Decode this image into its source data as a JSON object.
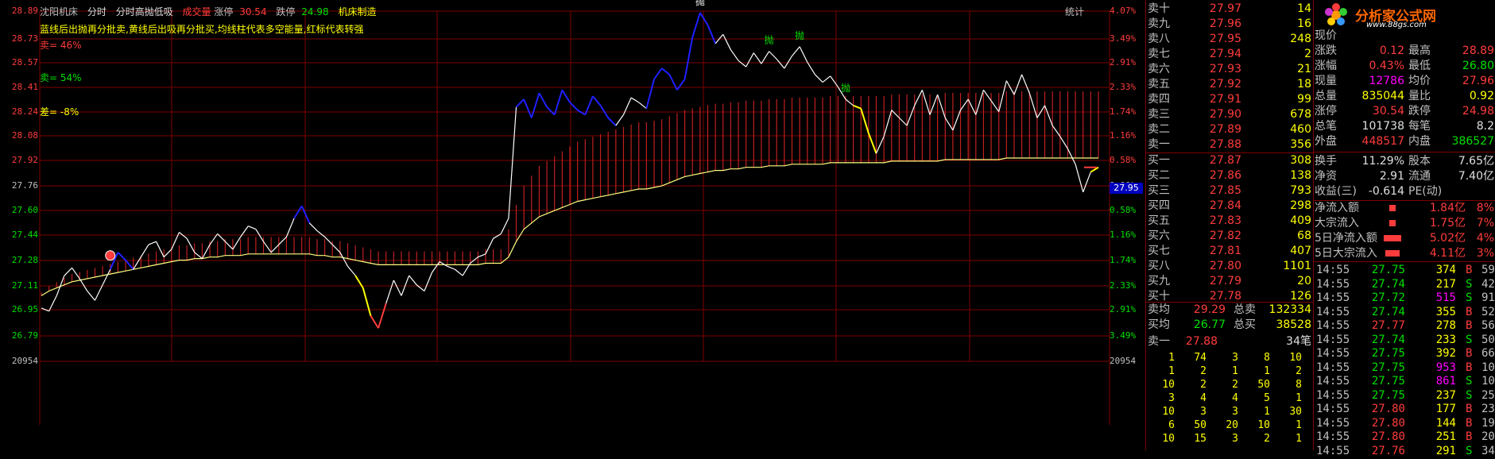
{
  "header": {
    "stock_name": "沈阳机床",
    "tab_fenshi": "分时",
    "indicator_name": "分时高抛低吸",
    "volume_label": "成交量",
    "limit_up_label": "涨停",
    "limit_up_value": "30.54",
    "limit_down_label": "跌停",
    "limit_down_value": "24.98",
    "credit": "机床制造",
    "hint_text": "蓝线后出抛再分批卖,黄线后出吸再分批买,均线柱代表多空能量,红标代表转强",
    "sell_pct": "卖= 46%",
    "sell2_pct": "卖= 54%",
    "diff_pct": "差= -8%",
    "stats_label": "统计"
  },
  "chart_data": {
    "type": "line",
    "y_left_ticks": [
      "28.89",
      "28.73",
      "28.57",
      "28.41",
      "28.24",
      "28.08",
      "27.92",
      "27.76",
      "27.60",
      "27.44",
      "27.28",
      "27.11",
      "26.95",
      "26.79",
      "20954"
    ],
    "y_right_ticks": [
      "4.07%",
      "3.49%",
      "2.91%",
      "2.33%",
      "1.74%",
      "1.16%",
      "0.58%",
      "0.00%",
      "0.58%",
      "1.16%",
      "1.74%",
      "2.33%",
      "2.91%",
      "3.49%",
      "20954"
    ],
    "current_price_tag": "27.95",
    "markers": [
      "抛",
      "抛",
      "抛",
      "抛"
    ],
    "price": [
      26.97,
      26.95,
      27.05,
      27.18,
      27.23,
      27.16,
      27.08,
      27.02,
      27.12,
      27.22,
      27.33,
      27.28,
      27.22,
      27.3,
      27.38,
      27.4,
      27.3,
      27.35,
      27.46,
      27.42,
      27.33,
      27.29,
      27.38,
      27.45,
      27.4,
      27.35,
      27.43,
      27.5,
      27.48,
      27.4,
      27.33,
      27.38,
      27.43,
      27.55,
      27.63,
      27.52,
      27.47,
      27.43,
      27.38,
      27.33,
      27.24,
      27.18,
      27.1,
      26.92,
      26.84,
      27.0,
      27.15,
      27.05,
      27.18,
      27.12,
      27.08,
      27.2,
      27.27,
      27.24,
      27.22,
      27.18,
      27.26,
      27.3,
      27.32,
      27.42,
      27.45,
      27.55,
      28.27,
      28.32,
      28.2,
      28.36,
      28.27,
      28.22,
      28.38,
      28.3,
      28.25,
      28.22,
      28.34,
      28.28,
      28.2,
      28.15,
      28.22,
      28.33,
      28.3,
      28.26,
      28.45,
      28.52,
      28.48,
      28.38,
      28.45,
      28.72,
      28.88,
      28.8,
      28.68,
      28.74,
      28.64,
      28.57,
      28.53,
      28.62,
      28.55,
      28.63,
      28.58,
      28.52,
      28.6,
      28.66,
      28.56,
      28.48,
      28.43,
      28.47,
      28.4,
      28.32,
      28.28,
      28.26,
      28.1,
      27.97,
      28.08,
      28.25,
      28.2,
      28.15,
      28.28,
      28.38,
      28.22,
      28.35,
      28.2,
      28.12,
      28.25,
      28.32,
      28.22,
      28.38,
      28.31,
      28.24,
      28.44,
      28.35,
      28.48,
      28.36,
      28.2,
      28.28,
      28.15,
      28.08,
      28.0,
      27.9,
      27.72,
      27.85,
      27.88
    ],
    "avg_price": [
      27.05,
      27.08,
      27.1,
      27.12,
      27.14,
      27.15,
      27.16,
      27.17,
      27.18,
      27.19,
      27.2,
      27.21,
      27.22,
      27.23,
      27.24,
      27.25,
      27.26,
      27.27,
      27.28,
      27.28,
      27.29,
      27.29,
      27.3,
      27.3,
      27.31,
      27.31,
      27.31,
      27.32,
      27.32,
      27.32,
      27.32,
      27.32,
      27.32,
      27.32,
      27.32,
      27.32,
      27.31,
      27.31,
      27.3,
      27.3,
      27.29,
      27.28,
      27.27,
      27.26,
      27.25,
      27.25,
      27.25,
      27.25,
      27.25,
      27.25,
      27.25,
      27.25,
      27.25,
      27.25,
      27.25,
      27.25,
      27.25,
      27.25,
      27.26,
      27.26,
      27.26,
      27.3,
      27.4,
      27.48,
      27.52,
      27.56,
      27.58,
      27.6,
      27.62,
      27.64,
      27.66,
      27.67,
      27.68,
      27.69,
      27.7,
      27.71,
      27.72,
      27.73,
      27.74,
      27.74,
      27.75,
      27.76,
      27.78,
      27.8,
      27.82,
      27.83,
      27.84,
      27.85,
      27.86,
      27.86,
      27.87,
      27.87,
      27.88,
      27.88,
      27.88,
      27.89,
      27.89,
      27.89,
      27.9,
      27.9,
      27.9,
      27.9,
      27.9,
      27.91,
      27.91,
      27.91,
      27.91,
      27.91,
      27.91,
      27.91,
      27.91,
      27.92,
      27.92,
      27.92,
      27.92,
      27.92,
      27.92,
      27.92,
      27.93,
      27.93,
      27.93,
      27.93,
      27.93,
      27.93,
      27.93,
      27.93,
      27.94,
      27.94,
      27.94,
      27.94,
      27.94,
      27.94,
      27.94,
      27.94,
      27.94,
      27.94,
      27.94,
      27.94,
      27.94
    ]
  },
  "orderbook": {
    "sells": [
      {
        "label": "卖十",
        "price": "27.97",
        "vol": "14"
      },
      {
        "label": "卖九",
        "price": "27.96",
        "vol": "16"
      },
      {
        "label": "卖八",
        "price": "27.95",
        "vol": "248"
      },
      {
        "label": "卖七",
        "price": "27.94",
        "vol": "2"
      },
      {
        "label": "卖六",
        "price": "27.93",
        "vol": "21"
      },
      {
        "label": "卖五",
        "price": "27.92",
        "vol": "18"
      },
      {
        "label": "卖四",
        "price": "27.91",
        "vol": "99"
      },
      {
        "label": "卖三",
        "price": "27.90",
        "vol": "678"
      },
      {
        "label": "卖二",
        "price": "27.89",
        "vol": "460"
      },
      {
        "label": "卖一",
        "price": "27.88",
        "vol": "356"
      }
    ],
    "buys": [
      {
        "label": "买一",
        "price": "27.87",
        "vol": "308"
      },
      {
        "label": "买二",
        "price": "27.86",
        "vol": "138"
      },
      {
        "label": "买三",
        "price": "27.85",
        "vol": "793"
      },
      {
        "label": "买四",
        "price": "27.84",
        "vol": "298"
      },
      {
        "label": "买五",
        "price": "27.83",
        "vol": "409"
      },
      {
        "label": "买六",
        "price": "27.82",
        "vol": "68"
      },
      {
        "label": "买七",
        "price": "27.81",
        "vol": "407"
      },
      {
        "label": "买八",
        "price": "27.80",
        "vol": "1101"
      },
      {
        "label": "买九",
        "price": "27.79",
        "vol": "20"
      },
      {
        "label": "买十",
        "price": "27.78",
        "vol": "126"
      }
    ],
    "avg_sell_label": "卖均",
    "avg_sell": "29.29",
    "total_sell_label": "总卖",
    "total_sell": "132334",
    "avg_buy_label": "买均",
    "avg_buy": "26.77",
    "total_buy_label": "总买",
    "total_buy": "38528",
    "sell1_label": "卖一",
    "sell1_price": "27.88",
    "sell1_count": "34笔",
    "queue": [
      [
        "1",
        "74",
        "3",
        "8",
        "10"
      ],
      [
        "1",
        "2",
        "1",
        "1",
        "2"
      ],
      [
        "10",
        "2",
        "2",
        "50",
        "8"
      ],
      [
        "3",
        "4",
        "4",
        "5",
        "1"
      ],
      [
        "10",
        "3",
        "3",
        "1",
        "30"
      ],
      [
        "6",
        "50",
        "20",
        "10",
        "1"
      ],
      [
        "10",
        "15",
        "3",
        "2",
        "1"
      ]
    ]
  },
  "logo": {
    "text": "分析家公式网",
    "url": "www.88gs.com"
  },
  "quote": {
    "current_label": "现价",
    "rows": [
      {
        "k1": "涨跌",
        "v1": "0.12",
        "k2": "最高",
        "v2": "28.89"
      },
      {
        "k1": "涨幅",
        "v1": "0.43%",
        "k2": "最低",
        "v2": "26.80"
      },
      {
        "k1": "现量",
        "v1": "12786",
        "k2": "均价",
        "v2": "27.96"
      },
      {
        "k1": "总量",
        "v1": "835044",
        "k2": "量比",
        "v2": "0.92"
      },
      {
        "k1": "涨停",
        "v1": "30.54",
        "k2": "跌停",
        "v2": "24.98"
      },
      {
        "k1": "总笔",
        "v1": "101738",
        "k2": "每笔",
        "v2": "8.2"
      },
      {
        "k1": "外盘",
        "v1": "448517",
        "k2": "内盘",
        "v2": "386527"
      },
      {
        "k1": "换手",
        "v1": "11.29%",
        "k2": "股本",
        "v2": "7.65亿"
      },
      {
        "k1": "净资",
        "v1": "2.91",
        "k2": "流通",
        "v2": "7.40亿"
      },
      {
        "k1": "收益(三)",
        "v1": "-0.614",
        "k2": "PE(动)",
        "v2": ""
      }
    ]
  },
  "flows": [
    {
      "label": "净流入额",
      "value": "1.84亿",
      "pct": "8%",
      "bar": 0.2
    },
    {
      "label": "大宗流入",
      "value": "1.75亿",
      "pct": "7%",
      "bar": 0.2
    },
    {
      "label": "5日净流入额",
      "value": "5.02亿",
      "pct": "4%",
      "bar": 0.55
    },
    {
      "label": "5日大宗流入",
      "value": "4.11亿",
      "pct": "3%",
      "bar": 0.45
    }
  ],
  "ticks": [
    {
      "t": "14:55",
      "p": "27.75",
      "v": "374",
      "bs": "B",
      "n": "59"
    },
    {
      "t": "14:55",
      "p": "27.74",
      "v": "217",
      "bs": "S",
      "n": "42"
    },
    {
      "t": "14:55",
      "p": "27.72",
      "v": "515",
      "bs": "S",
      "n": "91"
    },
    {
      "t": "14:55",
      "p": "27.74",
      "v": "355",
      "bs": "B",
      "n": "52"
    },
    {
      "t": "14:55",
      "p": "27.77",
      "v": "278",
      "bs": "B",
      "n": "56"
    },
    {
      "t": "14:55",
      "p": "27.74",
      "v": "233",
      "bs": "S",
      "n": "50"
    },
    {
      "t": "14:55",
      "p": "27.75",
      "v": "392",
      "bs": "B",
      "n": "66"
    },
    {
      "t": "14:55",
      "p": "27.75",
      "v": "953",
      "bs": "B",
      "n": "10"
    },
    {
      "t": "14:55",
      "p": "27.75",
      "v": "861",
      "bs": "S",
      "n": "10"
    },
    {
      "t": "14:55",
      "p": "27.75",
      "v": "237",
      "bs": "S",
      "n": "25"
    },
    {
      "t": "14:55",
      "p": "27.80",
      "v": "177",
      "bs": "B",
      "n": "23"
    },
    {
      "t": "14:55",
      "p": "27.80",
      "v": "144",
      "bs": "B",
      "n": "19"
    },
    {
      "t": "14:55",
      "p": "27.80",
      "v": "251",
      "bs": "B",
      "n": "20"
    },
    {
      "t": "14:55",
      "p": "27.76",
      "v": "291",
      "bs": "S",
      "n": "34"
    }
  ],
  "colors": {
    "up": "#ff3c3c",
    "down": "#00e000",
    "grid": "#800000",
    "avg": "#ffff80",
    "price": "#ffffff",
    "blue_seg": "#2020ff",
    "yellow_seg": "#ffff00"
  }
}
